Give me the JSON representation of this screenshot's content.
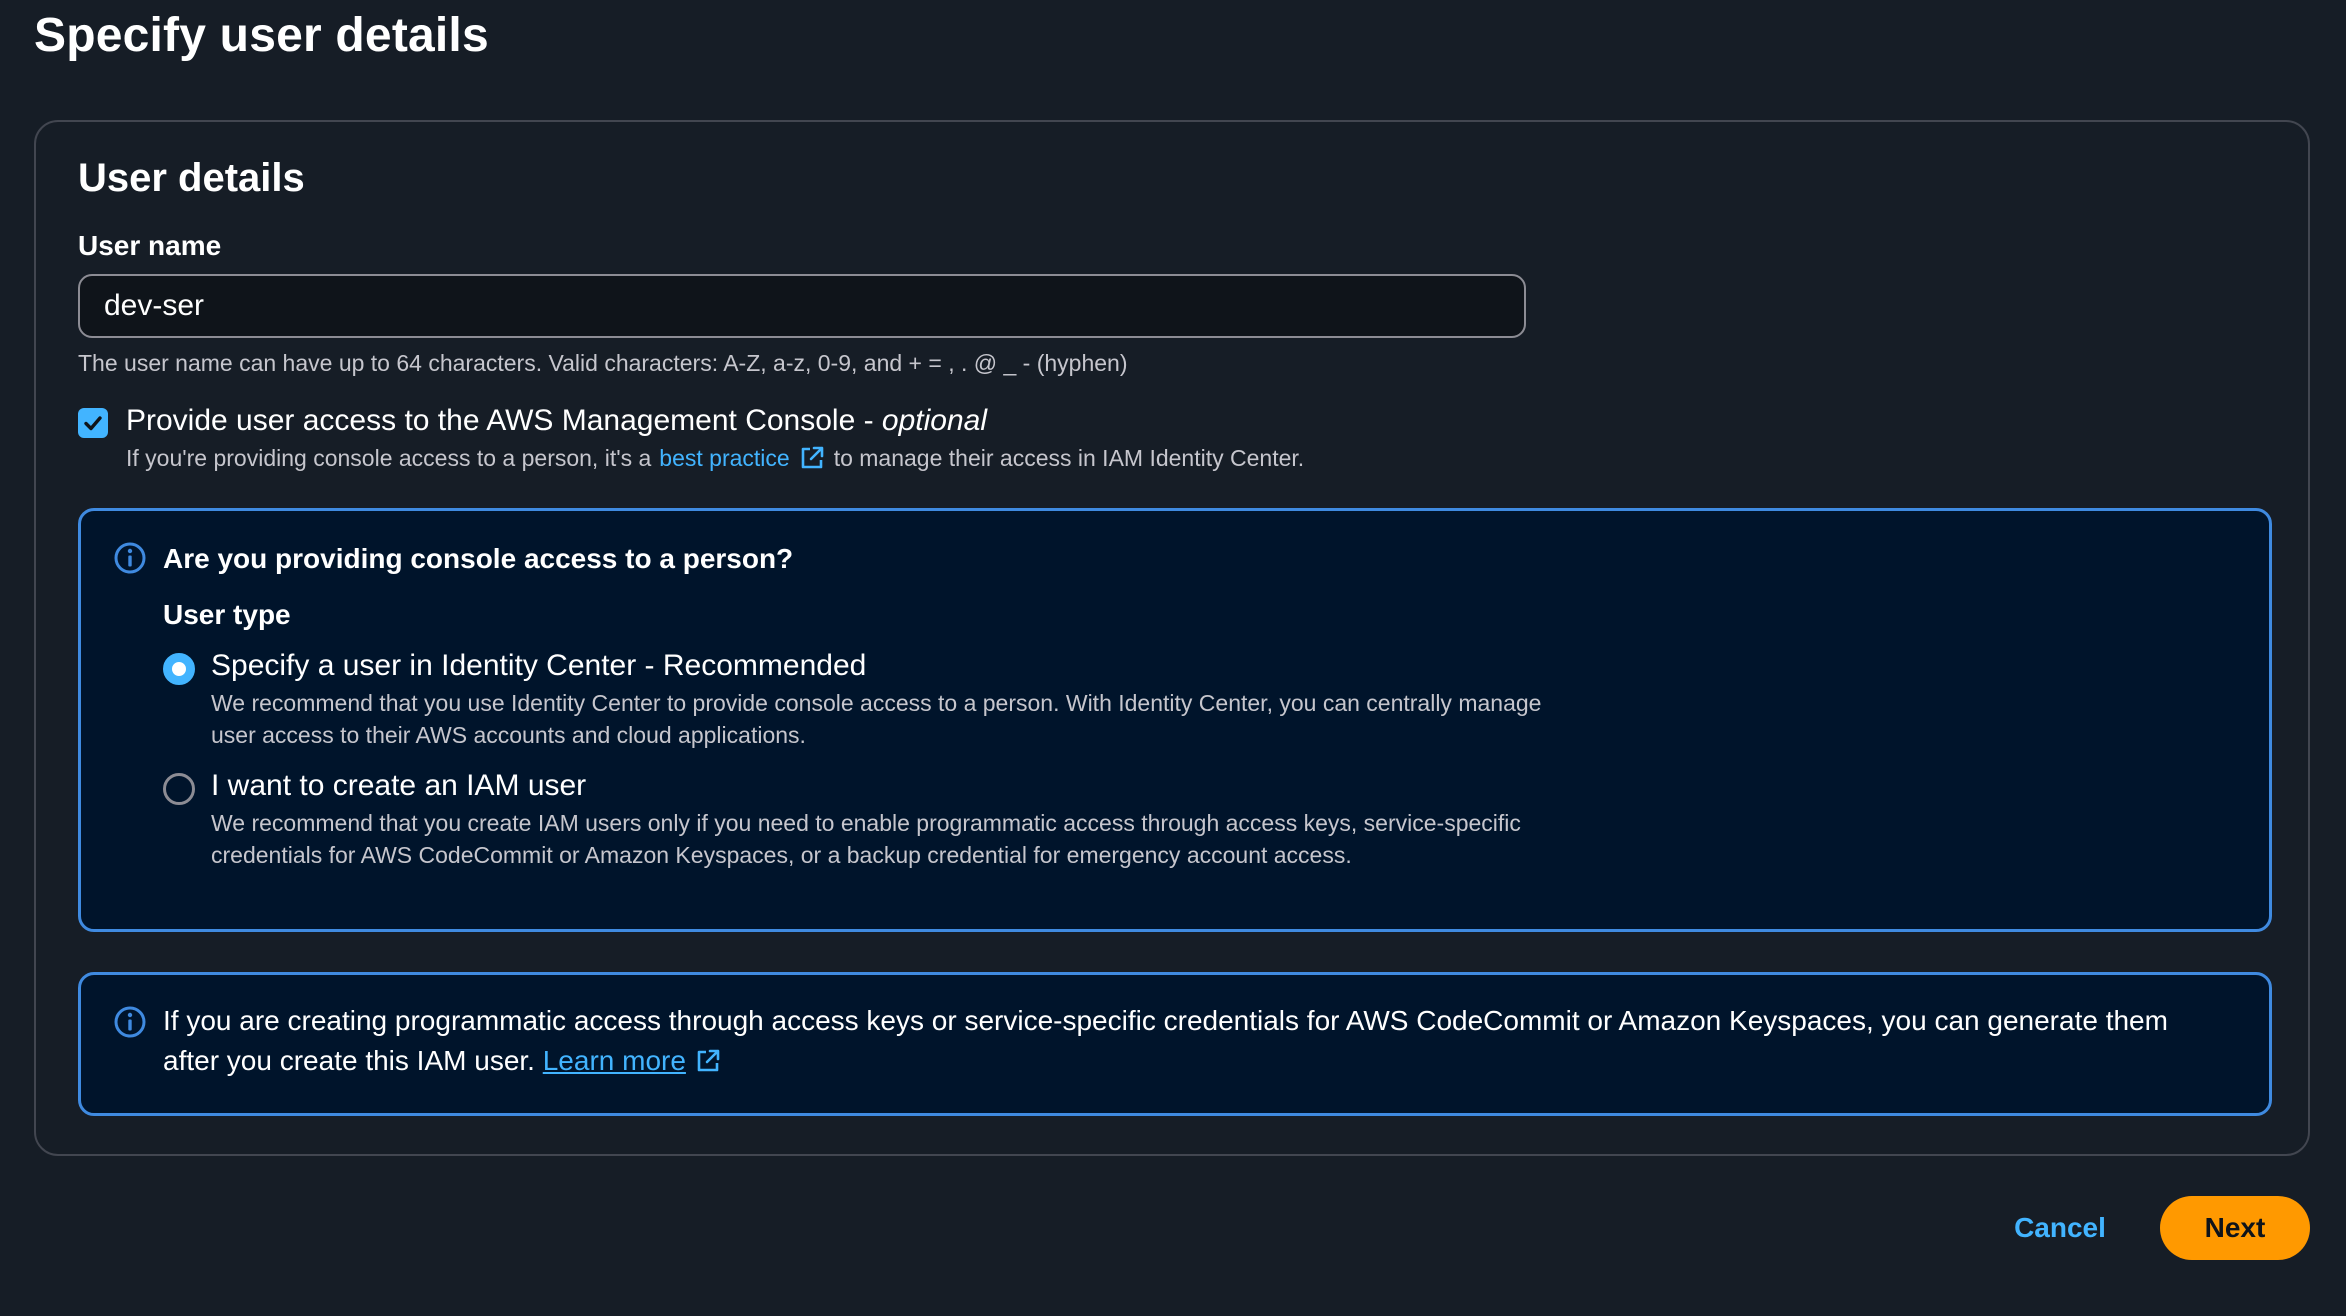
{
  "page": {
    "title": "Specify user details"
  },
  "panel": {
    "title": "User details",
    "user_name": {
      "label": "User name",
      "value": "dev-ser",
      "constraint": "The user name can have up to 64 characters. Valid characters: A-Z, a-z, 0-9, and + = , . @ _ - (hyphen)"
    },
    "console_access": {
      "checked": true,
      "label": "Provide user access to the AWS Management Console - ",
      "optional": "optional",
      "desc_before": "If you're providing console access to a person, it's a",
      "link": "best practice",
      "desc_after": "to manage their access in IAM Identity Center."
    },
    "person_alert": {
      "heading": "Are you providing console access to a person?",
      "user_type_label": "User type",
      "options": [
        {
          "label": "Specify a user in Identity Center - Recommended",
          "desc": "We recommend that you use Identity Center to provide console access to a person. With Identity Center, you can centrally manage user access to their AWS accounts and cloud applications.",
          "selected": true
        },
        {
          "label": "I want to create an IAM user",
          "desc": "We recommend that you create IAM users only if you need to enable programmatic access through access keys, service-specific credentials for AWS CodeCommit or Amazon Keyspaces, or a backup credential for emergency account access.",
          "selected": false
        }
      ]
    },
    "programmatic_alert": {
      "text": "If you are creating programmatic access through access keys or service-specific credentials for AWS CodeCommit or Amazon Keyspaces, you can generate them after you create this IAM user.",
      "link": "Learn more"
    }
  },
  "footer": {
    "cancel_label": "Cancel",
    "next_label": "Next"
  },
  "colors": {
    "accent": "#42b4ff",
    "primary_button": "#ff9900",
    "alert_border": "#3f8ae0",
    "background": "#161d26"
  },
  "icons": [
    "check-icon",
    "external-link-icon",
    "info-icon"
  ]
}
